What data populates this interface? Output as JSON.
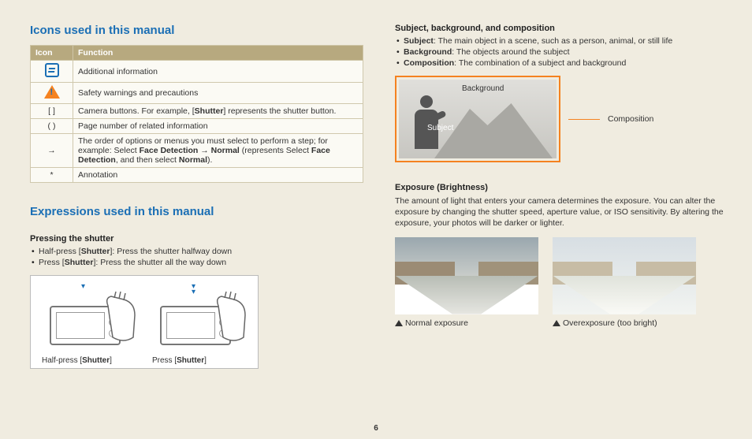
{
  "page_number": "6",
  "left": {
    "heading_icons": "Icons used in this manual",
    "table": {
      "headers": {
        "icon": "Icon",
        "function": "Function"
      },
      "rows": {
        "note": "Additional information",
        "warn": "Safety warnings and precautions",
        "brackets": {
          "icon": "[  ]",
          "text_a": "Camera buttons. For example, [",
          "bold": "Shutter",
          "text_b": "] represents the shutter button."
        },
        "paren": {
          "icon": "(  )",
          "text": "Page number of related information"
        },
        "arrow": {
          "icon": "→",
          "line1": "The order of options or menus you must select to perform a step; for example: Select ",
          "b1": "Face Detection",
          "mid1": " → ",
          "b2": "Normal",
          "mid2": " (represents Select ",
          "b3": "Face Detection",
          "mid3": ", and then select ",
          "b4": "Normal",
          "end": ")."
        },
        "star": {
          "icon": "*",
          "text": "Annotation"
        }
      }
    },
    "heading_expr": "Expressions used in this manual",
    "pressing": {
      "title": "Pressing the shutter",
      "bullet1": {
        "a": "Half-press [",
        "b": "Shutter",
        "c": "]: Press the shutter halfway down"
      },
      "bullet2": {
        "a": "Press [",
        "b": "Shutter",
        "c": "]: Press the shutter all the way down"
      },
      "cap1": {
        "a": "Half-press [",
        "b": "Shutter",
        "c": "]"
      },
      "cap2": {
        "a": "Press [",
        "b": "Shutter",
        "c": "]"
      }
    }
  },
  "right": {
    "sbc": {
      "title": "Subject, background, and composition",
      "subject": {
        "b": "Subject",
        "t": ": The main object in a scene, such as a person, animal, or still life"
      },
      "background": {
        "b": "Background",
        "t": ": The objects around the subject"
      },
      "composition": {
        "b": "Composition",
        "t": ": The combination of a subject and background"
      },
      "lbl_bg": "Background",
      "lbl_sub": "Subject",
      "lbl_comp": "Composition"
    },
    "exposure": {
      "title": "Exposure (Brightness)",
      "para": "The amount of light that enters your camera determines the exposure. You can alter the exposure by changing the shutter speed, aperture value, or ISO sensitivity. By altering the exposure, your photos will be darker or lighter.",
      "cap1": "Normal exposure",
      "cap2": "Overexposure (too bright)"
    }
  }
}
